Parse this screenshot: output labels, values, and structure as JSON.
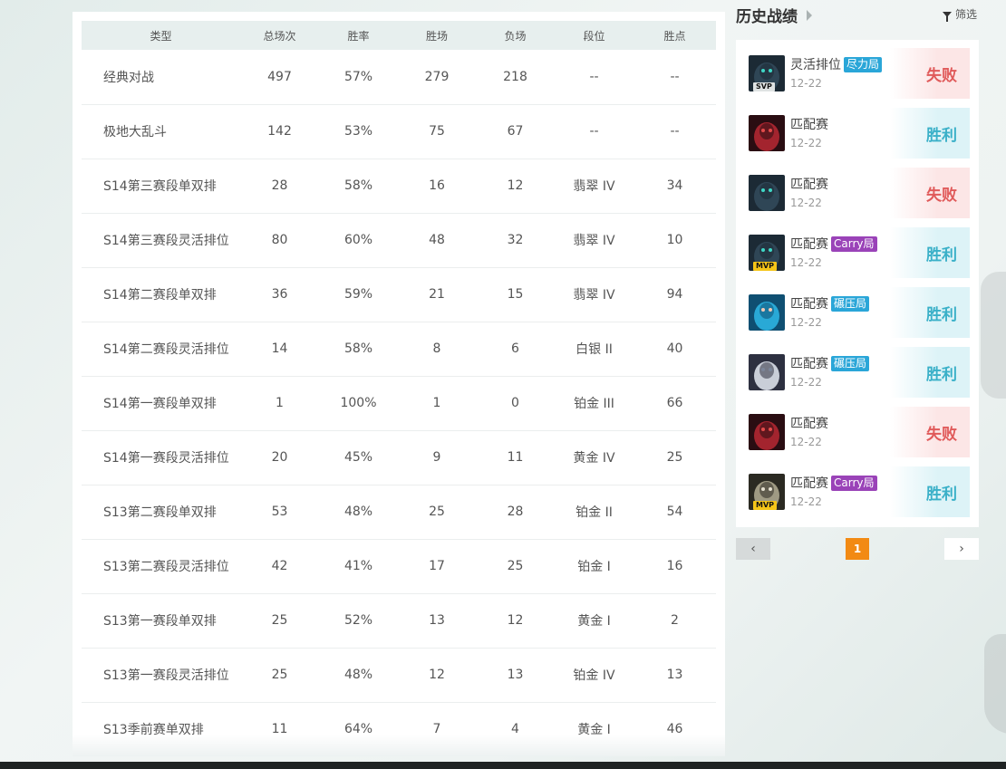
{
  "stats": {
    "headers": [
      "类型",
      "总场次",
      "胜率",
      "胜场",
      "负场",
      "段位",
      "胜点"
    ],
    "rows": [
      [
        "经典对战",
        "497",
        "57%",
        "279",
        "218",
        "--",
        "--"
      ],
      [
        "极地大乱斗",
        "142",
        "53%",
        "75",
        "67",
        "--",
        "--"
      ],
      [
        "S14第三赛段单双排",
        "28",
        "58%",
        "16",
        "12",
        "翡翠 IV",
        "34"
      ],
      [
        "S14第三赛段灵活排位",
        "80",
        "60%",
        "48",
        "32",
        "翡翠 IV",
        "10"
      ],
      [
        "S14第二赛段单双排",
        "36",
        "59%",
        "21",
        "15",
        "翡翠 IV",
        "94"
      ],
      [
        "S14第二赛段灵活排位",
        "14",
        "58%",
        "8",
        "6",
        "白银 II",
        "40"
      ],
      [
        "S14第一赛段单双排",
        "1",
        "100%",
        "1",
        "0",
        "铂金 III",
        "66"
      ],
      [
        "S14第一赛段灵活排位",
        "20",
        "45%",
        "9",
        "11",
        "黄金 IV",
        "25"
      ],
      [
        "S13第二赛段单双排",
        "53",
        "48%",
        "25",
        "28",
        "铂金 II",
        "54"
      ],
      [
        "S13第二赛段灵活排位",
        "42",
        "41%",
        "17",
        "25",
        "铂金 I",
        "16"
      ],
      [
        "S13第一赛段单双排",
        "25",
        "52%",
        "13",
        "12",
        "黄金 I",
        "2"
      ],
      [
        "S13第一赛段灵活排位",
        "25",
        "48%",
        "12",
        "13",
        "铂金 IV",
        "13"
      ],
      [
        "S13季前赛单双排",
        "11",
        "64%",
        "7",
        "4",
        "黄金 I",
        "46"
      ]
    ]
  },
  "history": {
    "title": "历史战绩",
    "filter_label": "筛选",
    "matches": [
      {
        "mode": "灵活排位",
        "tag": "尽力局",
        "tag_color": "#2aa6d8",
        "badge": "SVP",
        "date": "12-22",
        "result": "失败",
        "outcome": "lose",
        "hero": "dark-warrior"
      },
      {
        "mode": "匹配赛",
        "tag": "",
        "tag_color": "",
        "badge": "",
        "date": "12-22",
        "result": "胜利",
        "outcome": "win",
        "hero": "red-mask"
      },
      {
        "mode": "匹配赛",
        "tag": "",
        "tag_color": "",
        "badge": "",
        "date": "12-22",
        "result": "失败",
        "outcome": "lose",
        "hero": "dark-warrior"
      },
      {
        "mode": "匹配赛",
        "tag": "Carry局",
        "tag_color": "#9a43b8",
        "badge": "MVP",
        "date": "12-22",
        "result": "胜利",
        "outcome": "win",
        "hero": "dark-warrior"
      },
      {
        "mode": "匹配赛",
        "tag": "碾压局",
        "tag_color": "#2aa6d8",
        "badge": "",
        "date": "12-22",
        "result": "胜利",
        "outcome": "win",
        "hero": "blue-girl"
      },
      {
        "mode": "匹配赛",
        "tag": "碾压局",
        "tag_color": "#2aa6d8",
        "badge": "",
        "date": "12-22",
        "result": "胜利",
        "outcome": "win",
        "hero": "white-wolf"
      },
      {
        "mode": "匹配赛",
        "tag": "",
        "tag_color": "",
        "badge": "",
        "date": "12-22",
        "result": "失败",
        "outcome": "lose",
        "hero": "red-mask"
      },
      {
        "mode": "匹配赛",
        "tag": "Carry局",
        "tag_color": "#9a43b8",
        "badge": "MVP",
        "date": "12-22",
        "result": "胜利",
        "outcome": "win",
        "hero": "old-sage"
      }
    ]
  },
  "pagination": {
    "prev_icon": "‹",
    "current_page": "1",
    "next_icon": "›"
  },
  "colors": {
    "accent_orange": "#f28a14",
    "win": "#3ab0c8",
    "lose": "#e05a5a"
  }
}
